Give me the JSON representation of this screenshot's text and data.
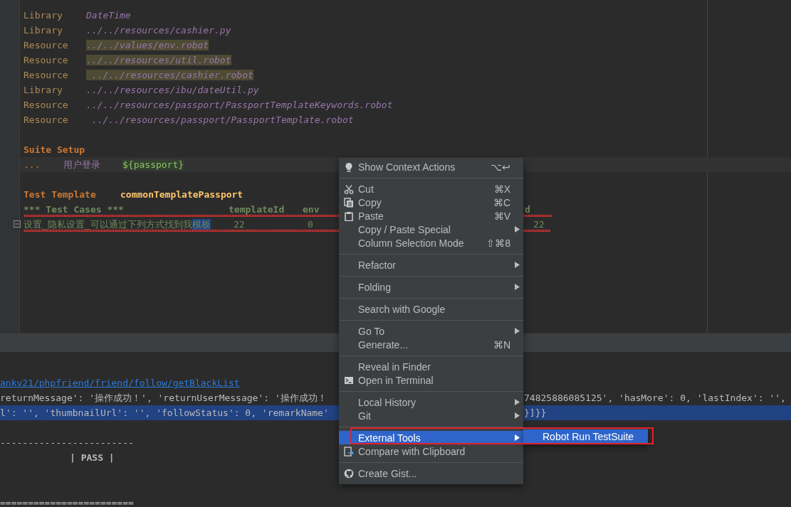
{
  "editor": {
    "lines": [
      {
        "kind": "setting",
        "keyword": "Library",
        "value": "DateTime",
        "highlighted": false
      },
      {
        "kind": "setting",
        "keyword": "Library",
        "value": "../../resources/cashier.py",
        "highlighted": false
      },
      {
        "kind": "setting",
        "keyword": "Resource",
        "value": "../../values/env.robot",
        "highlighted": true
      },
      {
        "kind": "setting",
        "keyword": "Resource",
        "value": "../../resources/util.robot",
        "highlighted": true
      },
      {
        "kind": "setting",
        "keyword": "Resource",
        "value": " ../../resources/cashier.robot",
        "highlighted": true
      },
      {
        "kind": "setting",
        "keyword": "Library",
        "value": "../../resources/ibu/dateUtil.py",
        "highlighted": false
      },
      {
        "kind": "setting",
        "keyword": "Resource",
        "value": "../../resources/passport/PassportTemplateKeywords.robot",
        "highlighted": false
      },
      {
        "kind": "setting",
        "keyword": "Resource",
        "value": " ../../resources/passport/PassportTemplate.robot",
        "highlighted": false
      },
      {
        "kind": "blank"
      },
      {
        "kind": "section",
        "title": "Suite Setup"
      },
      {
        "kind": "continuation",
        "cells": [
          "...",
          "用户登录",
          "${passport}"
        ],
        "current": true
      },
      {
        "kind": "blank"
      },
      {
        "kind": "template",
        "keyword": "Test Template",
        "value": "commonTemplatePassport"
      },
      {
        "kind": "table-header",
        "cells": [
          "*** Test Cases ***",
          "templateId",
          "env",
          "d"
        ],
        "error": true
      },
      {
        "kind": "test-case",
        "name": "设置_隐私设置_可以通过下列方式找到我",
        "selection": "模板",
        "cells": [
          "22",
          "0",
          "22"
        ],
        "error": true,
        "folded": false
      }
    ]
  },
  "console": {
    "lines": [
      {
        "kind": "blank"
      },
      {
        "kind": "link",
        "text": "ankv21/phpfriend/friend/follow/getBlackList"
      },
      {
        "kind": "text",
        "text": "returnMessage': '操作成功！', 'returnUserMessage': '操作成功！",
        "text_right": "74825886085125', 'hasMore': 0, 'lastIndex': '',",
        "selected": false
      },
      {
        "kind": "text",
        "text": "l': '', 'thumbnailUrl': '', 'followStatus': 0, 'remarkName'",
        "text_right": "}]}}",
        "selected": true
      },
      {
        "kind": "blank"
      },
      {
        "kind": "text",
        "text": "------------------------",
        "selected": false
      },
      {
        "kind": "status",
        "text": "| PASS |"
      },
      {
        "kind": "blank"
      },
      {
        "kind": "blank"
      },
      {
        "kind": "text",
        "text": "========================",
        "selected": false
      }
    ]
  },
  "context_menu": {
    "items": [
      {
        "kind": "item",
        "label": "Show Context Actions",
        "shortcut": "⌥↩",
        "submenu": false,
        "selected": false
      },
      {
        "kind": "separator"
      },
      {
        "kind": "item",
        "label": "Cut",
        "shortcut": "⌘X",
        "submenu": false,
        "selected": false
      },
      {
        "kind": "item",
        "label": "Copy",
        "shortcut": "⌘C",
        "submenu": false,
        "selected": false
      },
      {
        "kind": "item",
        "label": "Paste",
        "shortcut": "⌘V",
        "submenu": false,
        "selected": false
      },
      {
        "kind": "item",
        "label": "Copy / Paste Special",
        "submenu": true,
        "selected": false
      },
      {
        "kind": "item",
        "label": "Column Selection Mode",
        "shortcut": "⇧⌘8",
        "submenu": false,
        "selected": false
      },
      {
        "kind": "separator"
      },
      {
        "kind": "item",
        "label": "Refactor",
        "submenu": true,
        "selected": false
      },
      {
        "kind": "separator"
      },
      {
        "kind": "item",
        "label": "Folding",
        "submenu": true,
        "selected": false
      },
      {
        "kind": "separator"
      },
      {
        "kind": "item",
        "label": "Search with Google",
        "submenu": false,
        "selected": false
      },
      {
        "kind": "separator"
      },
      {
        "kind": "item",
        "label": "Go To",
        "submenu": true,
        "selected": false
      },
      {
        "kind": "item",
        "label": "Generate...",
        "shortcut": "⌘N",
        "submenu": false,
        "selected": false
      },
      {
        "kind": "separator"
      },
      {
        "kind": "item",
        "label": "Reveal in Finder",
        "submenu": false,
        "selected": false
      },
      {
        "kind": "item",
        "label": "Open in Terminal",
        "submenu": false,
        "selected": false
      },
      {
        "kind": "separator"
      },
      {
        "kind": "item",
        "label": "Local History",
        "submenu": true,
        "selected": false
      },
      {
        "kind": "item",
        "label": "Git",
        "submenu": true,
        "selected": false
      },
      {
        "kind": "separator"
      },
      {
        "kind": "item",
        "label": "External Tools",
        "submenu": true,
        "selected": true,
        "submenu_items": [
          {
            "label": "Robot Run TestSuite",
            "selected": true
          }
        ]
      },
      {
        "kind": "item",
        "label": "Compare with Clipboard",
        "submenu": false,
        "selected": false
      },
      {
        "kind": "separator"
      },
      {
        "kind": "item",
        "label": "Create Gist...",
        "submenu": false,
        "selected": false
      }
    ]
  }
}
